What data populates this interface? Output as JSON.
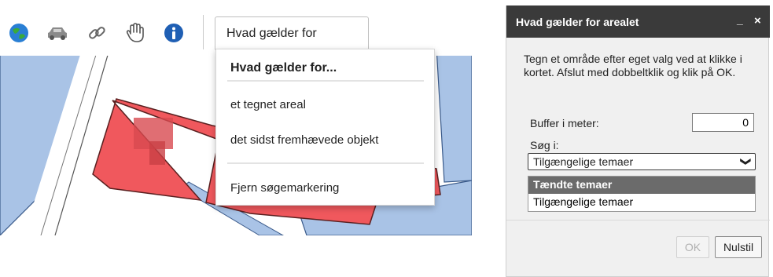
{
  "toolbar": {
    "icons": [
      {
        "name": "globe-icon"
      },
      {
        "name": "car-icon"
      },
      {
        "name": "link-icon"
      },
      {
        "name": "hand-icon"
      },
      {
        "name": "info-icon"
      }
    ],
    "hvad_select_label": "Hvad gælder for"
  },
  "hvad_menu": {
    "header": "Hvad gælder for...",
    "items": [
      "et tegnet areal",
      "det sidst fremhævede objekt"
    ],
    "clear_item": "Fjern søgemarkering"
  },
  "panel": {
    "title": "Hvad gælder for arealet",
    "minimize_label": "_",
    "close_label": "×",
    "instructions": "Tegn et område efter eget valg ved at klikke i kortet. Afslut med dobbeltklik og klik på OK.",
    "buffer_label": "Buffer i meter:",
    "buffer_value": "0",
    "search_label": "Søg i:",
    "search_selected": "Tilgængelige temaer",
    "search_options": [
      "Tændte temaer",
      "Tilgængelige temaer"
    ],
    "ok_label": "OK",
    "reset_label": "Nulstil"
  },
  "colors": {
    "parcel_red": "#f0585d",
    "area_blue": "#a9c3e6",
    "panel_title_bg": "#3a3a3a"
  }
}
